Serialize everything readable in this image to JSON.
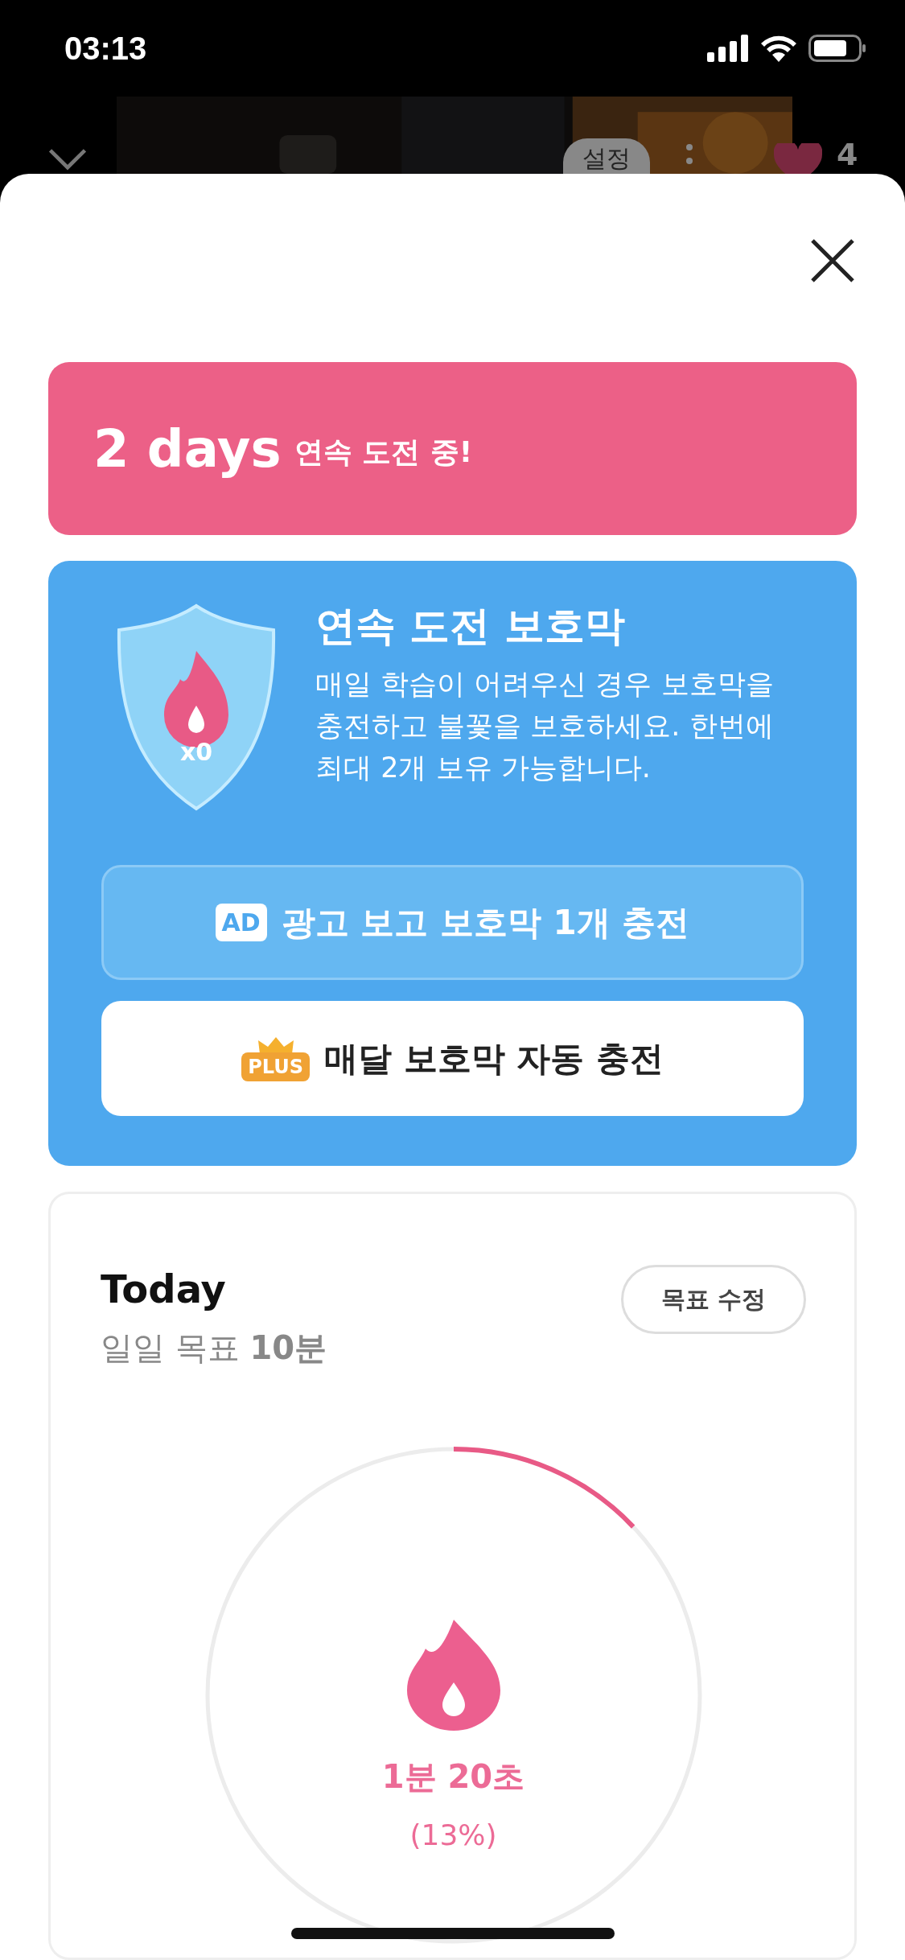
{
  "status_bar": {
    "time": "03:13"
  },
  "player_header": {
    "tooltip": "설정",
    "like_count": "4"
  },
  "streak_banner": {
    "days": "2 days",
    "label": "연속 도전 중!"
  },
  "shield_card": {
    "count": "x0",
    "title": "연속 도전 보호막",
    "description": "매일 학습이 어려우신 경우 보호막을 충전하고 불꽃을 보호하세요. 한번에 최대 2개 보유 가능합니다.",
    "buttons": [
      {
        "kind": "ad",
        "badge": "AD",
        "label": "광고 보고 보호막 1개 충전"
      },
      {
        "kind": "plus",
        "badge": "PLUS",
        "label": "매달 보호막 자동 충전"
      }
    ]
  },
  "today_card": {
    "title": "Today",
    "goal": "일일 목표 **10분**",
    "edit_button": "목표 수정",
    "level": 0.13,
    "time": "1분 20초",
    "percent": "(13%)"
  }
}
